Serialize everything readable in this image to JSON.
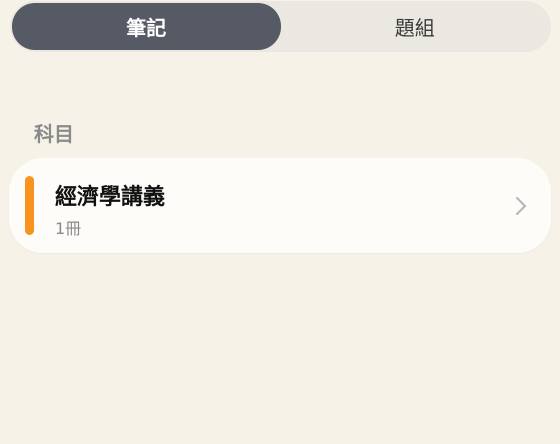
{
  "tabs": [
    {
      "label": "筆記",
      "active": true
    },
    {
      "label": "題組",
      "active": false
    }
  ],
  "section": {
    "title": "科目"
  },
  "subjects": [
    {
      "title": "經濟學講義",
      "count": "1冊",
      "accent_color": "#f7931e"
    }
  ],
  "icons": {
    "chevron": "chevron-right-icon"
  }
}
